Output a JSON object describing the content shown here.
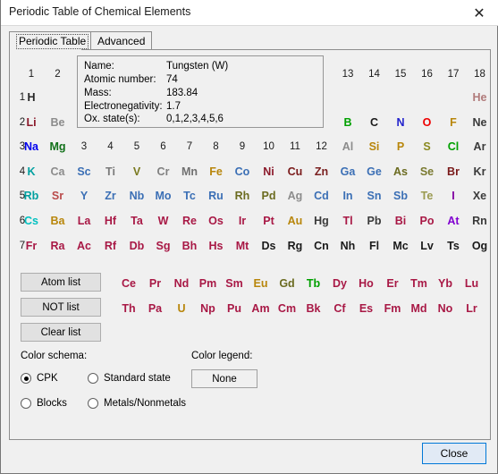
{
  "window": {
    "title": "Periodic Table of Chemical Elements",
    "close_icon": "close-x-icon"
  },
  "tabs": [
    {
      "label": "Periodic Table",
      "active": true
    },
    {
      "label": "Advanced",
      "active": false
    }
  ],
  "info": {
    "rows": [
      {
        "label": "Name:",
        "value": "Tungsten (W)"
      },
      {
        "label": "Atomic number:",
        "value": "74"
      },
      {
        "label": "Mass:",
        "value": "183.84"
      },
      {
        "label": "Electronegativity:",
        "value": "1.7"
      },
      {
        "label": "Ox. state(s):",
        "value": "0,1,2,3,4,5,6"
      }
    ]
  },
  "table": {
    "group_headers_left": [
      "1",
      "2"
    ],
    "group_headers_mid": [
      "3",
      "4",
      "5",
      "6",
      "7",
      "8",
      "9",
      "10",
      "11",
      "12"
    ],
    "group_headers_right": [
      "13",
      "14",
      "15",
      "16",
      "17",
      "18"
    ],
    "period_labels": [
      "1",
      "2",
      "3",
      "4",
      "5",
      "6",
      "7"
    ],
    "elements": [
      {
        "sym": "H",
        "g": 1,
        "p": 1,
        "color": "#262626"
      },
      {
        "sym": "He",
        "g": 18,
        "p": 1,
        "color": "#b07a7a"
      },
      {
        "sym": "Li",
        "g": 1,
        "p": 2,
        "color": "#8b1a2b"
      },
      {
        "sym": "Be",
        "g": 2,
        "p": 2,
        "color": "#8c8c8c"
      },
      {
        "sym": "B",
        "g": 13,
        "p": 2,
        "color": "#00a000"
      },
      {
        "sym": "C",
        "g": 14,
        "p": 2,
        "color": "#1a1a1a"
      },
      {
        "sym": "N",
        "g": 15,
        "p": 2,
        "color": "#2222cc"
      },
      {
        "sym": "O",
        "g": 16,
        "p": 2,
        "color": "#ee0000"
      },
      {
        "sym": "F",
        "g": 17,
        "p": 2,
        "color": "#b8860b"
      },
      {
        "sym": "Ne",
        "g": 18,
        "p": 2,
        "color": "#3a3a3a"
      },
      {
        "sym": "Na",
        "g": 1,
        "p": 3,
        "color": "#0000ee"
      },
      {
        "sym": "Mg",
        "g": 2,
        "p": 3,
        "color": "#12711a"
      },
      {
        "sym": "Al",
        "g": 13,
        "p": 3,
        "color": "#8c8c8c"
      },
      {
        "sym": "Si",
        "g": 14,
        "p": 3,
        "color": "#b8860b"
      },
      {
        "sym": "P",
        "g": 15,
        "p": 3,
        "color": "#b8860b"
      },
      {
        "sym": "S",
        "g": 16,
        "p": 3,
        "color": "#8a8a20"
      },
      {
        "sym": "Cl",
        "g": 17,
        "p": 3,
        "color": "#00a000"
      },
      {
        "sym": "Ar",
        "g": 18,
        "p": 3,
        "color": "#3a3a3a"
      },
      {
        "sym": "K",
        "g": 1,
        "p": 4,
        "color": "#00a0a0"
      },
      {
        "sym": "Ca",
        "g": 2,
        "p": 4,
        "color": "#8c8c8c"
      },
      {
        "sym": "Sc",
        "g": 3,
        "p": 4,
        "color": "#3b6fb5"
      },
      {
        "sym": "Ti",
        "g": 4,
        "p": 4,
        "color": "#7a7a7a"
      },
      {
        "sym": "V",
        "g": 5,
        "p": 4,
        "color": "#7a7a20"
      },
      {
        "sym": "Cr",
        "g": 6,
        "p": 4,
        "color": "#808080"
      },
      {
        "sym": "Mn",
        "g": 7,
        "p": 4,
        "color": "#707070"
      },
      {
        "sym": "Fe",
        "g": 8,
        "p": 4,
        "color": "#b8860b"
      },
      {
        "sym": "Co",
        "g": 9,
        "p": 4,
        "color": "#3b6fb5"
      },
      {
        "sym": "Ni",
        "g": 10,
        "p": 4,
        "color": "#8b1a2b"
      },
      {
        "sym": "Cu",
        "g": 11,
        "p": 4,
        "color": "#7a1a1a"
      },
      {
        "sym": "Zn",
        "g": 12,
        "p": 4,
        "color": "#7a2020"
      },
      {
        "sym": "Ga",
        "g": 13,
        "p": 4,
        "color": "#3b6fb5"
      },
      {
        "sym": "Ge",
        "g": 14,
        "p": 4,
        "color": "#3b6fb5"
      },
      {
        "sym": "As",
        "g": 15,
        "p": 4,
        "color": "#6b6b20"
      },
      {
        "sym": "Se",
        "g": 16,
        "p": 4,
        "color": "#7a7a30"
      },
      {
        "sym": "Br",
        "g": 17,
        "p": 4,
        "color": "#7a1a1a"
      },
      {
        "sym": "Kr",
        "g": 18,
        "p": 4,
        "color": "#3a3a3a"
      },
      {
        "sym": "Rb",
        "g": 1,
        "p": 5,
        "color": "#00a0a0"
      },
      {
        "sym": "Sr",
        "g": 2,
        "p": 5,
        "color": "#b94a4a"
      },
      {
        "sym": "Y",
        "g": 3,
        "p": 5,
        "color": "#3b6fb5"
      },
      {
        "sym": "Zr",
        "g": 4,
        "p": 5,
        "color": "#3b6fb5"
      },
      {
        "sym": "Nb",
        "g": 5,
        "p": 5,
        "color": "#3b6fb5"
      },
      {
        "sym": "Mo",
        "g": 6,
        "p": 5,
        "color": "#3b6fb5"
      },
      {
        "sym": "Tc",
        "g": 7,
        "p": 5,
        "color": "#3b6fb5"
      },
      {
        "sym": "Ru",
        "g": 8,
        "p": 5,
        "color": "#3b6fb5"
      },
      {
        "sym": "Rh",
        "g": 9,
        "p": 5,
        "color": "#6b6b20"
      },
      {
        "sym": "Pd",
        "g": 10,
        "p": 5,
        "color": "#6b6b20"
      },
      {
        "sym": "Ag",
        "g": 11,
        "p": 5,
        "color": "#8c8c8c"
      },
      {
        "sym": "Cd",
        "g": 12,
        "p": 5,
        "color": "#3b6fb5"
      },
      {
        "sym": "In",
        "g": 13,
        "p": 5,
        "color": "#3b6fb5"
      },
      {
        "sym": "Sn",
        "g": 14,
        "p": 5,
        "color": "#3b6fb5"
      },
      {
        "sym": "Sb",
        "g": 15,
        "p": 5,
        "color": "#3b6fb5"
      },
      {
        "sym": "Te",
        "g": 16,
        "p": 5,
        "color": "#9a9a50"
      },
      {
        "sym": "I",
        "g": 17,
        "p": 5,
        "color": "#8000a0"
      },
      {
        "sym": "Xe",
        "g": 18,
        "p": 5,
        "color": "#3a3a3a"
      },
      {
        "sym": "Cs",
        "g": 1,
        "p": 6,
        "color": "#00c0c0"
      },
      {
        "sym": "Ba",
        "g": 2,
        "p": 6,
        "color": "#b8860b"
      },
      {
        "sym": "La",
        "g": 3,
        "p": 6,
        "color": "#a81845"
      },
      {
        "sym": "Hf",
        "g": 4,
        "p": 6,
        "color": "#a81845"
      },
      {
        "sym": "Ta",
        "g": 5,
        "p": 6,
        "color": "#a81845"
      },
      {
        "sym": "W",
        "g": 6,
        "p": 6,
        "color": "#a81845"
      },
      {
        "sym": "Re",
        "g": 7,
        "p": 6,
        "color": "#a81845"
      },
      {
        "sym": "Os",
        "g": 8,
        "p": 6,
        "color": "#a81845"
      },
      {
        "sym": "Ir",
        "g": 9,
        "p": 6,
        "color": "#a81845"
      },
      {
        "sym": "Pt",
        "g": 10,
        "p": 6,
        "color": "#a81845"
      },
      {
        "sym": "Au",
        "g": 11,
        "p": 6,
        "color": "#b8860b"
      },
      {
        "sym": "Hg",
        "g": 12,
        "p": 6,
        "color": "#3a3a3a"
      },
      {
        "sym": "Tl",
        "g": 13,
        "p": 6,
        "color": "#a81845"
      },
      {
        "sym": "Pb",
        "g": 14,
        "p": 6,
        "color": "#3a3a3a"
      },
      {
        "sym": "Bi",
        "g": 15,
        "p": 6,
        "color": "#a81845"
      },
      {
        "sym": "Po",
        "g": 16,
        "p": 6,
        "color": "#a81845"
      },
      {
        "sym": "At",
        "g": 17,
        "p": 6,
        "color": "#8000d0"
      },
      {
        "sym": "Rn",
        "g": 18,
        "p": 6,
        "color": "#3a3a3a"
      },
      {
        "sym": "Fr",
        "g": 1,
        "p": 7,
        "color": "#a81845"
      },
      {
        "sym": "Ra",
        "g": 2,
        "p": 7,
        "color": "#a81845"
      },
      {
        "sym": "Ac",
        "g": 3,
        "p": 7,
        "color": "#a81845"
      },
      {
        "sym": "Rf",
        "g": 4,
        "p": 7,
        "color": "#a81845"
      },
      {
        "sym": "Db",
        "g": 5,
        "p": 7,
        "color": "#a81845"
      },
      {
        "sym": "Sg",
        "g": 6,
        "p": 7,
        "color": "#a81845"
      },
      {
        "sym": "Bh",
        "g": 7,
        "p": 7,
        "color": "#a81845"
      },
      {
        "sym": "Hs",
        "g": 8,
        "p": 7,
        "color": "#a81845"
      },
      {
        "sym": "Mt",
        "g": 9,
        "p": 7,
        "color": "#a81845"
      },
      {
        "sym": "Ds",
        "g": 10,
        "p": 7,
        "color": "#1a1a1a"
      },
      {
        "sym": "Rg",
        "g": 11,
        "p": 7,
        "color": "#1a1a1a"
      },
      {
        "sym": "Cn",
        "g": 12,
        "p": 7,
        "color": "#1a1a1a"
      },
      {
        "sym": "Nh",
        "g": 13,
        "p": 7,
        "color": "#1a1a1a"
      },
      {
        "sym": "Fl",
        "g": 14,
        "p": 7,
        "color": "#1a1a1a"
      },
      {
        "sym": "Mc",
        "g": 15,
        "p": 7,
        "color": "#1a1a1a"
      },
      {
        "sym": "Lv",
        "g": 16,
        "p": 7,
        "color": "#1a1a1a"
      },
      {
        "sym": "Ts",
        "g": 17,
        "p": 7,
        "color": "#1a1a1a"
      },
      {
        "sym": "Og",
        "g": 18,
        "p": 7,
        "color": "#1a1a1a"
      }
    ],
    "lanthanides": [
      {
        "sym": "Ce",
        "color": "#a81845"
      },
      {
        "sym": "Pr",
        "color": "#a81845"
      },
      {
        "sym": "Nd",
        "color": "#a81845"
      },
      {
        "sym": "Pm",
        "color": "#a81845"
      },
      {
        "sym": "Sm",
        "color": "#a81845"
      },
      {
        "sym": "Eu",
        "color": "#b8860b"
      },
      {
        "sym": "Gd",
        "color": "#6b6b20"
      },
      {
        "sym": "Tb",
        "color": "#00a000"
      },
      {
        "sym": "Dy",
        "color": "#a81845"
      },
      {
        "sym": "Ho",
        "color": "#a81845"
      },
      {
        "sym": "Er",
        "color": "#a81845"
      },
      {
        "sym": "Tm",
        "color": "#a81845"
      },
      {
        "sym": "Yb",
        "color": "#a81845"
      },
      {
        "sym": "Lu",
        "color": "#a81845"
      }
    ],
    "actinides": [
      {
        "sym": "Th",
        "color": "#a81845"
      },
      {
        "sym": "Pa",
        "color": "#a81845"
      },
      {
        "sym": "U",
        "color": "#b8860b"
      },
      {
        "sym": "Np",
        "color": "#a81845"
      },
      {
        "sym": "Pu",
        "color": "#a81845"
      },
      {
        "sym": "Am",
        "color": "#a81845"
      },
      {
        "sym": "Cm",
        "color": "#a81845"
      },
      {
        "sym": "Bk",
        "color": "#a81845"
      },
      {
        "sym": "Cf",
        "color": "#a81845"
      },
      {
        "sym": "Es",
        "color": "#a81845"
      },
      {
        "sym": "Fm",
        "color": "#a81845"
      },
      {
        "sym": "Md",
        "color": "#a81845"
      },
      {
        "sym": "No",
        "color": "#a81845"
      },
      {
        "sym": "Lr",
        "color": "#a81845"
      }
    ]
  },
  "buttons": {
    "atom_list": "Atom list",
    "not_list": "NOT list",
    "clear_list": "Clear list",
    "legend_value": "None",
    "close": "Close"
  },
  "options": {
    "color_schema_label": "Color schema:",
    "color_legend_label": "Color legend:",
    "radios": [
      {
        "label": "CPK",
        "checked": true
      },
      {
        "label": "Blocks",
        "checked": false
      },
      {
        "label": "Standard state",
        "checked": false
      },
      {
        "label": "Metals/Nonmetals",
        "checked": false
      }
    ]
  }
}
